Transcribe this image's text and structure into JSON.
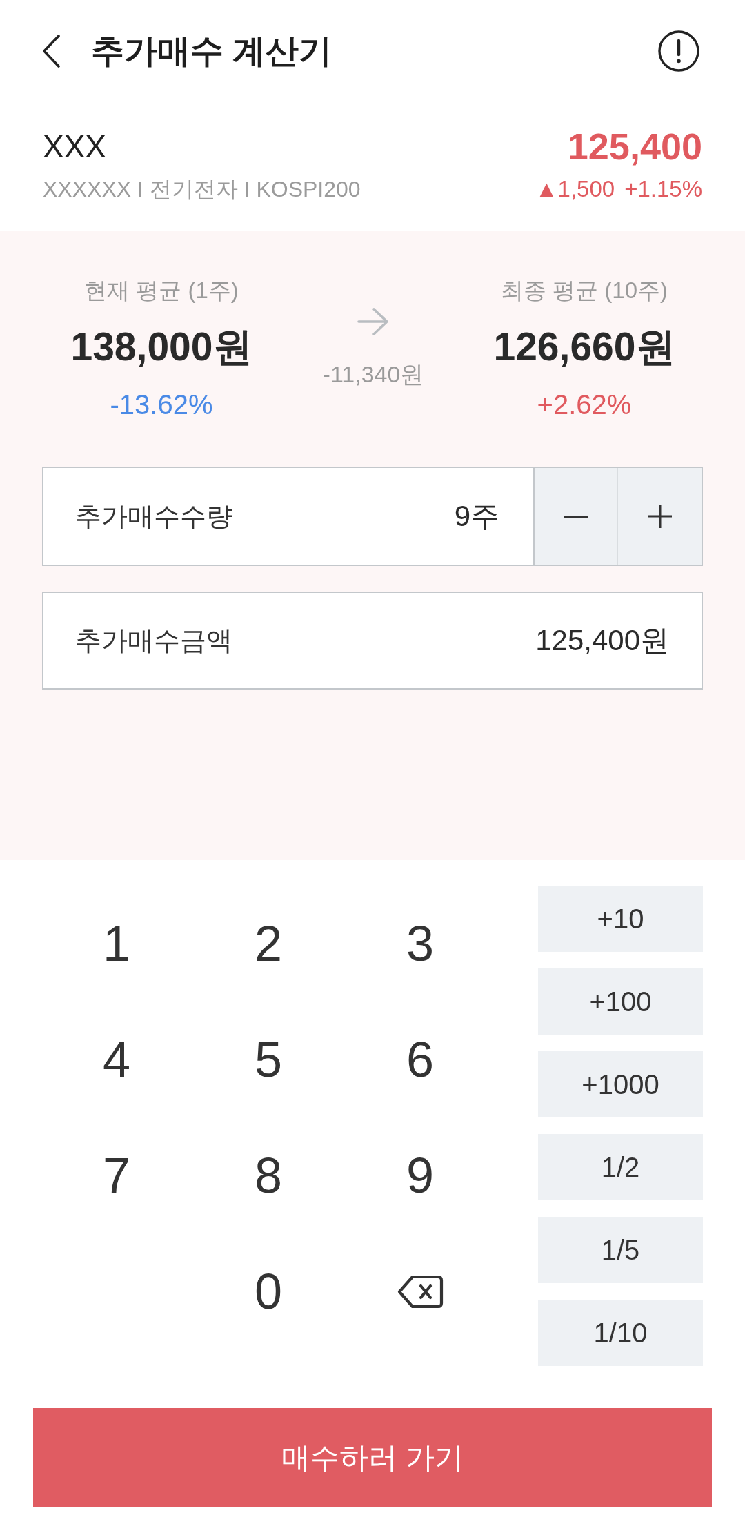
{
  "header": {
    "title": "추가매수 계산기"
  },
  "stock": {
    "name": "XXX",
    "meta": "XXXXXX I 전기전자 I KOSPI200",
    "price": "125,400",
    "change": "▲1,500",
    "change_rate": "+1.15%",
    "rising": true
  },
  "averages": [
    {
      "label": "현재 평균 (1주)",
      "price": "138,000원",
      "rate": "-13.62%",
      "rising": false
    },
    {
      "label": "최종 평균 (10주)",
      "price": "126,660원",
      "rate": "+2.62%",
      "rising": true
    }
  ],
  "difference": "-11,340원",
  "quantity": {
    "label": "추가매수수량",
    "value": "9주"
  },
  "amount": {
    "label": "추가매수금액",
    "value": "125,400원"
  },
  "keypad": {
    "keys": [
      {
        "kind": "digit",
        "label": "1"
      },
      {
        "kind": "digit",
        "label": "2"
      },
      {
        "kind": "digit",
        "label": "3"
      },
      {
        "kind": "digit",
        "label": "4"
      },
      {
        "kind": "digit",
        "label": "5"
      },
      {
        "kind": "digit",
        "label": "6"
      },
      {
        "kind": "digit",
        "label": "7"
      },
      {
        "kind": "digit",
        "label": "8"
      },
      {
        "kind": "digit",
        "label": "9"
      },
      {
        "kind": "digit",
        "label": "0"
      },
      {
        "kind": "backspace"
      }
    ],
    "quick_buttons": [
      "+10",
      "+100",
      "+1000",
      "1/2",
      "1/5",
      "1/10"
    ]
  },
  "submit_button": {
    "label": "매수하러 가기"
  }
}
